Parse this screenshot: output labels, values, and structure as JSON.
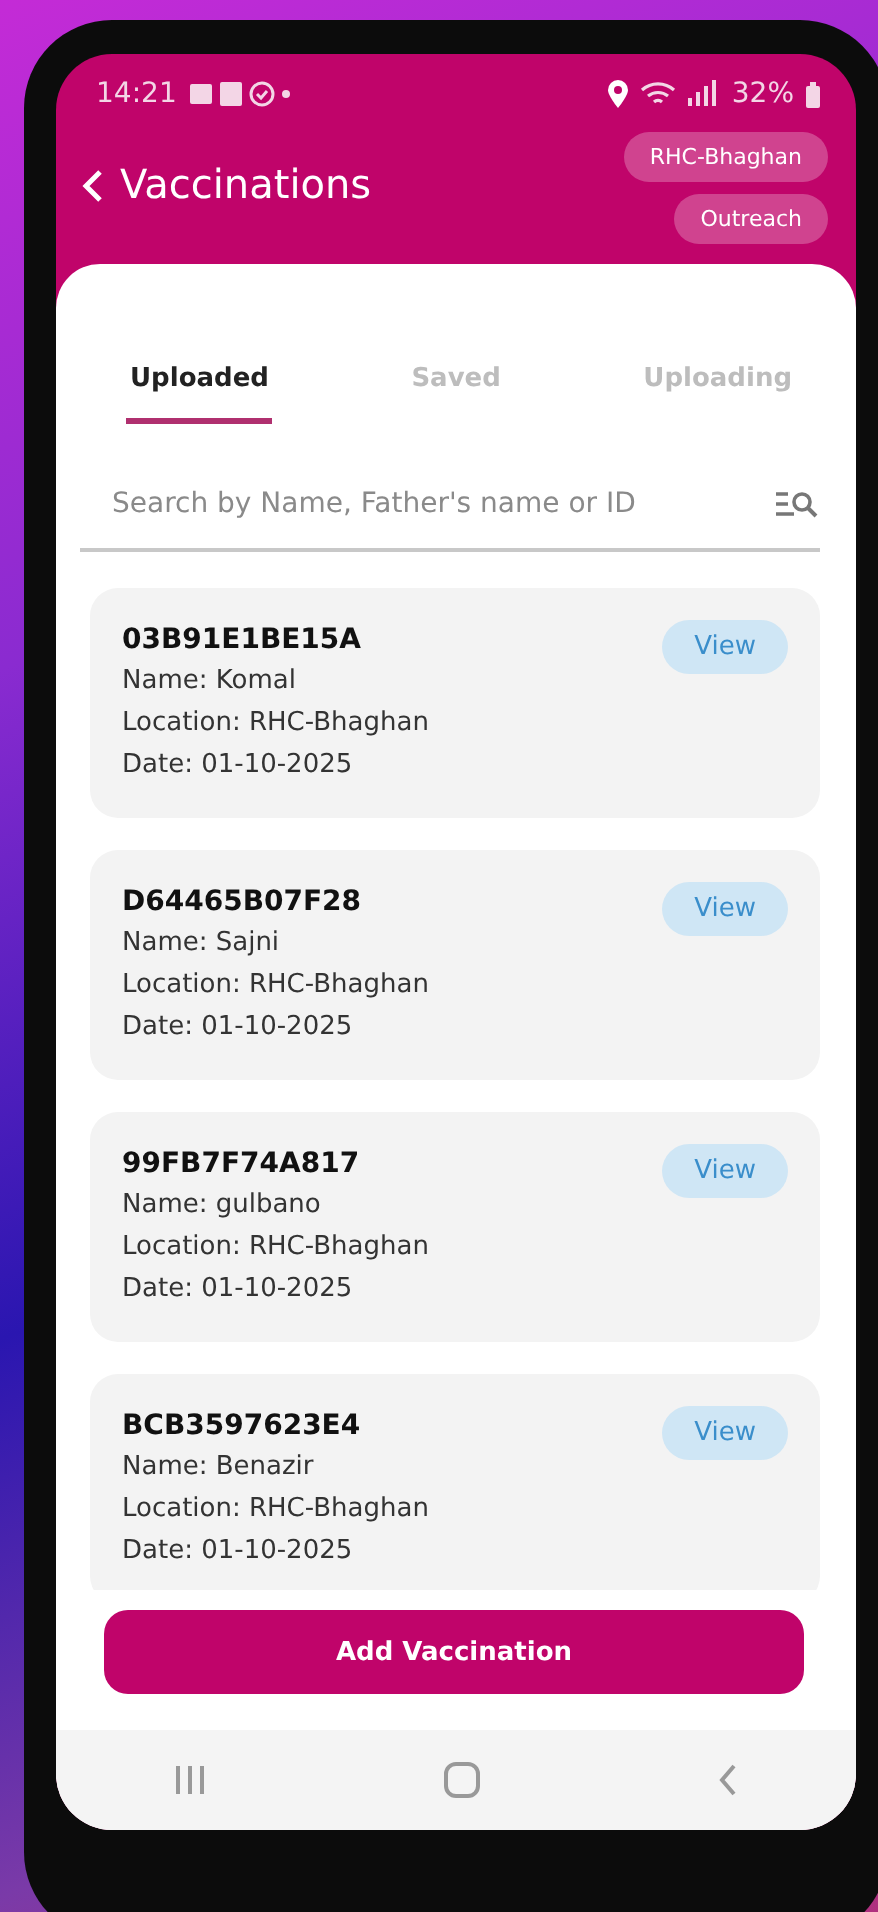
{
  "status_bar": {
    "time": "14:21",
    "battery": "32%"
  },
  "header": {
    "title": "Vaccinations",
    "chips": [
      "RHC-Bhaghan",
      "Outreach"
    ]
  },
  "tabs": [
    {
      "label": "Uploaded",
      "selected": true
    },
    {
      "label": "Saved",
      "selected": false
    },
    {
      "label": "Uploading",
      "selected": false
    }
  ],
  "search": {
    "placeholder": "Search by Name, Father's name or ID"
  },
  "records": [
    {
      "id": "03B91E1BE15A",
      "name": "Name: Komal",
      "location": "Location: RHC-Bhaghan",
      "date": "Date: 01-10-2025",
      "action": "View"
    },
    {
      "id": "D64465B07F28",
      "name": "Name: Sajni",
      "location": "Location: RHC-Bhaghan",
      "date": "Date: 01-10-2025",
      "action": "View"
    },
    {
      "id": "99FB7F74A817",
      "name": "Name: gulbano",
      "location": "Location: RHC-Bhaghan",
      "date": "Date: 01-10-2025",
      "action": "View"
    },
    {
      "id": "BCB3597623E4",
      "name": "Name: Benazir",
      "location": "Location: RHC-Bhaghan",
      "date": "Date: 01-10-2025",
      "action": "View"
    }
  ],
  "primary_button": "Add Vaccination"
}
